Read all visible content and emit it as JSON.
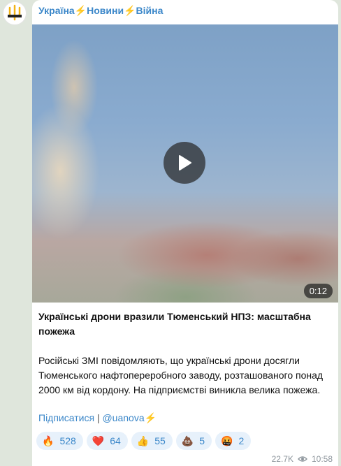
{
  "channel": {
    "name_parts": [
      "Україна",
      "⚡",
      "Новини",
      "⚡",
      "Війна"
    ]
  },
  "video": {
    "duration": "0:12",
    "play_icon": "play-icon"
  },
  "post": {
    "headline": "Українські дрони вразили Тюменський НПЗ: масштабна пожежа",
    "body": "Російські ЗМІ повідомляють, що українські дрони досягли Тюменського нафтопереробного заводу, розташованого понад 2000 км від кордону. На підприємстві виникла велика пожежа.",
    "subscribe_label": "Підписатися",
    "separator": "|",
    "handle": "@uanova",
    "handle_suffix": "⚡"
  },
  "reactions": [
    {
      "emoji": "🔥",
      "icon": "fire-icon",
      "count": "528"
    },
    {
      "emoji": "❤️",
      "icon": "heart-icon",
      "count": "64"
    },
    {
      "emoji": "👍",
      "icon": "thumbs-up-icon",
      "count": "55"
    },
    {
      "emoji": "💩",
      "icon": "poop-icon",
      "count": "5"
    },
    {
      "emoji": "🤬",
      "icon": "angry-face-icon",
      "count": "2"
    }
  ],
  "meta": {
    "views": "22.7K",
    "time": "10:58",
    "views_icon": "eye-icon"
  },
  "colors": {
    "accent": "#3b87c9",
    "bolt": "#f2b417",
    "reaction_bg": "#e7f1fb",
    "background": "#dfe6dc"
  }
}
